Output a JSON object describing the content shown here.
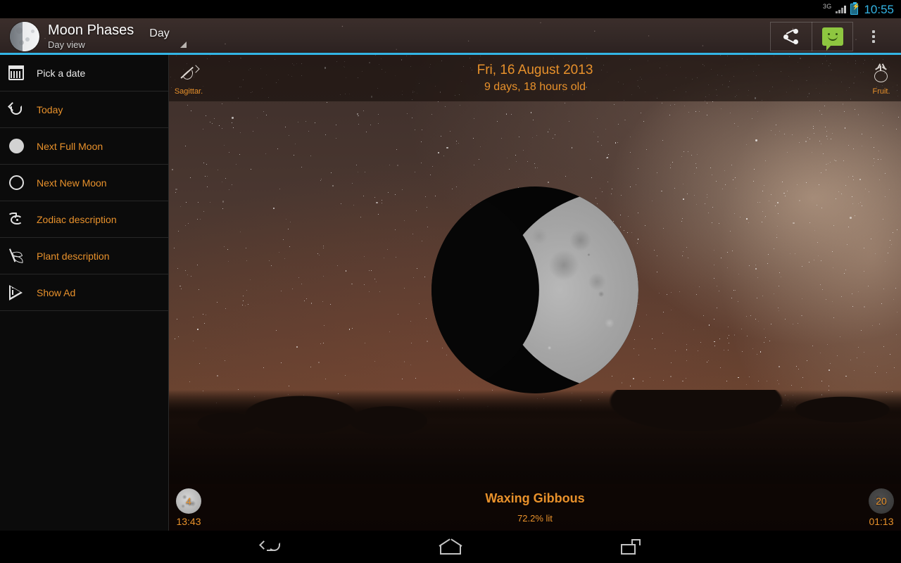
{
  "statusbar": {
    "network": "3G",
    "clock": "10:55",
    "battery_icon": "battery-charging-icon",
    "signal_icon": "signal-bars-icon"
  },
  "actionbar": {
    "app_icon": "moon-phase-app-icon",
    "title": "Moon Phases",
    "subtitle": "Day view",
    "spinner_value": "Day",
    "share_icon": "share-icon",
    "message_icon": "messaging-icon",
    "overflow_icon": "overflow-menu-icon",
    "accent_color": "#33b5e5"
  },
  "drawer": {
    "items": [
      {
        "label": "Pick a date",
        "icon": "calendar-icon",
        "style": "white"
      },
      {
        "label": "Today",
        "icon": "undo-arrow-icon",
        "style": "orange"
      },
      {
        "label": "Next Full Moon",
        "icon": "full-moon-icon",
        "style": "orange"
      },
      {
        "label": "Next New Moon",
        "icon": "new-moon-icon",
        "style": "orange"
      },
      {
        "label": "Zodiac description",
        "icon": "zodiac-goat-icon",
        "style": "orange"
      },
      {
        "label": "Plant description",
        "icon": "plant-leaf-icon",
        "style": "orange"
      },
      {
        "label": "Show Ad",
        "icon": "play-info-icon",
        "style": "orange"
      }
    ]
  },
  "topinfo": {
    "zodiac_label": "Sagittar.",
    "zodiac_icon": "sagittarius-bow-icon",
    "date": "Fri, 16 August 2013",
    "age": "9 days, 18 hours old",
    "plant_label": "Fruit.",
    "plant_icon": "fruit-tomato-icon"
  },
  "bottominfo": {
    "moonrise_day": "4",
    "moonrise_time": "13:43",
    "phase_name": "Waxing Gibbous",
    "illumination": "72.2% lit",
    "moonset_day": "20",
    "moonset_time": "01:13"
  },
  "navbar": {
    "back_icon": "back-icon",
    "home_icon": "home-icon",
    "recents_icon": "recents-icon"
  },
  "colors": {
    "accent_orange": "#e8912b",
    "holo_blue": "#33b5e5",
    "drawer_bg": "#0b0b0b"
  }
}
